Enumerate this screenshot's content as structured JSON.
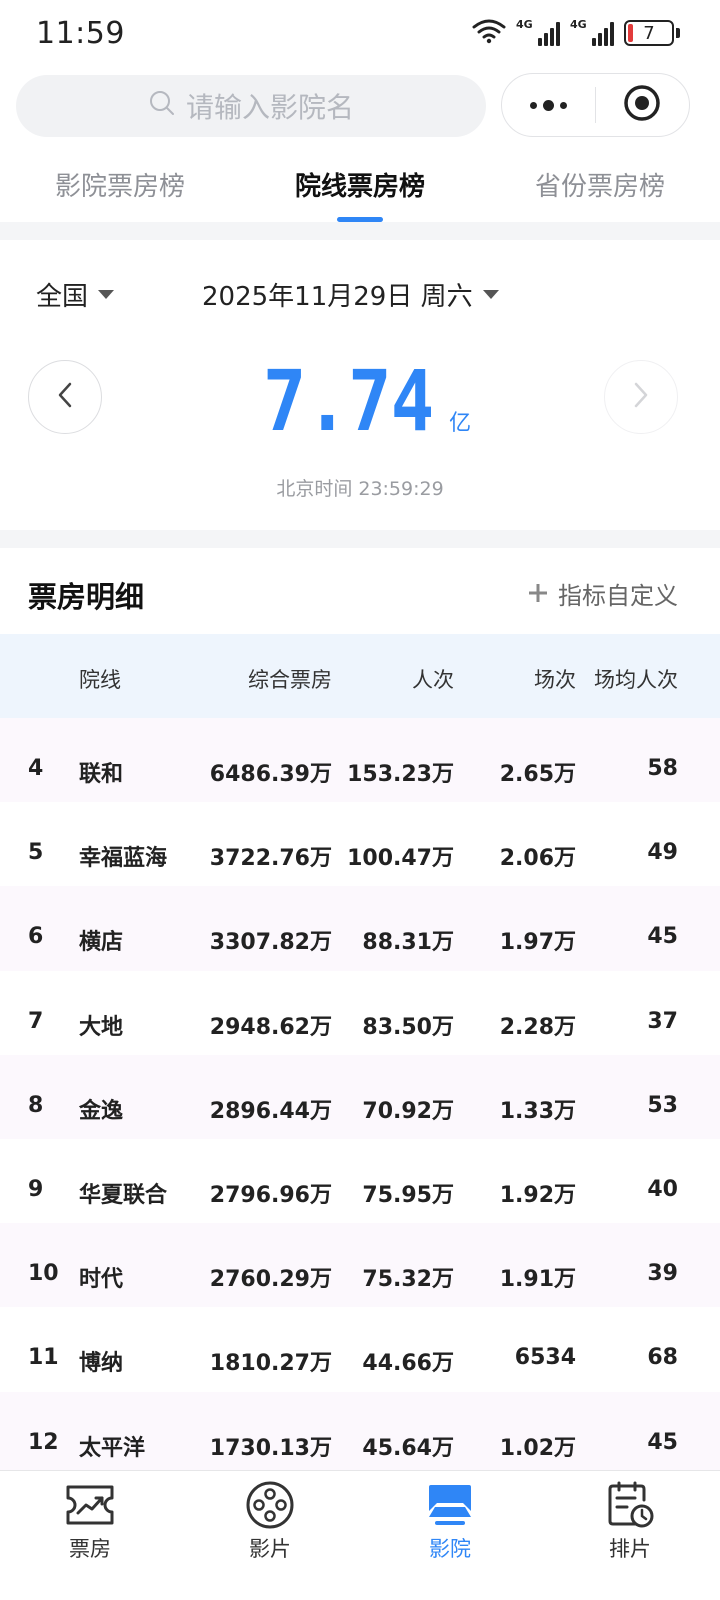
{
  "status_bar": {
    "time": "11:59",
    "network_1": "4G",
    "network_2": "4G",
    "battery": "7"
  },
  "search": {
    "placeholder": "请输入影院名"
  },
  "top_tabs": [
    {
      "label": "影院票房榜",
      "active": false
    },
    {
      "label": "院线票房榜",
      "active": true
    },
    {
      "label": "省份票房榜",
      "active": false
    }
  ],
  "summary": {
    "region": "全国",
    "date": "2025年11月29日 周六",
    "total_value": "7.74",
    "total_unit": "亿",
    "beijing_time": "北京时间 23:59:29"
  },
  "detail": {
    "title": "票房明细",
    "custom_label": "指标自定义",
    "columns": [
      "院线",
      "综合票房",
      "人次",
      "场次",
      "场均人次"
    ],
    "rows": [
      {
        "rank": "4",
        "name": "联和",
        "box": "6486.39万",
        "pax": "153.23万",
        "shows": "2.65万",
        "avg": "58"
      },
      {
        "rank": "5",
        "name": "幸福蓝海",
        "box": "3722.76万",
        "pax": "100.47万",
        "shows": "2.06万",
        "avg": "49"
      },
      {
        "rank": "6",
        "name": "横店",
        "box": "3307.82万",
        "pax": "88.31万",
        "shows": "1.97万",
        "avg": "45"
      },
      {
        "rank": "7",
        "name": "大地",
        "box": "2948.62万",
        "pax": "83.50万",
        "shows": "2.28万",
        "avg": "37"
      },
      {
        "rank": "8",
        "name": "金逸",
        "box": "2896.44万",
        "pax": "70.92万",
        "shows": "1.33万",
        "avg": "53"
      },
      {
        "rank": "9",
        "name": "华夏联合",
        "box": "2796.96万",
        "pax": "75.95万",
        "shows": "1.92万",
        "avg": "40"
      },
      {
        "rank": "10",
        "name": "时代",
        "box": "2760.29万",
        "pax": "75.32万",
        "shows": "1.91万",
        "avg": "39"
      },
      {
        "rank": "11",
        "name": "博纳",
        "box": "1810.27万",
        "pax": "44.66万",
        "shows": "6534",
        "avg": "68"
      },
      {
        "rank": "12",
        "name": "太平洋",
        "box": "1730.13万",
        "pax": "45.64万",
        "shows": "1.02万",
        "avg": "45"
      }
    ]
  },
  "tabbar": [
    {
      "label": "票房",
      "icon": "box-office-ticket-icon",
      "active": false
    },
    {
      "label": "影片",
      "icon": "film-reel-icon",
      "active": false
    },
    {
      "label": "影院",
      "icon": "cinema-screen-icon",
      "active": true
    },
    {
      "label": "排片",
      "icon": "schedule-clock-icon",
      "active": false
    }
  ],
  "colors": {
    "accent": "#2f86f6",
    "header_row_bg": "#eef5fd",
    "odd_row_bg": "#fcf8fd",
    "battery_low": "#e23b3b"
  }
}
